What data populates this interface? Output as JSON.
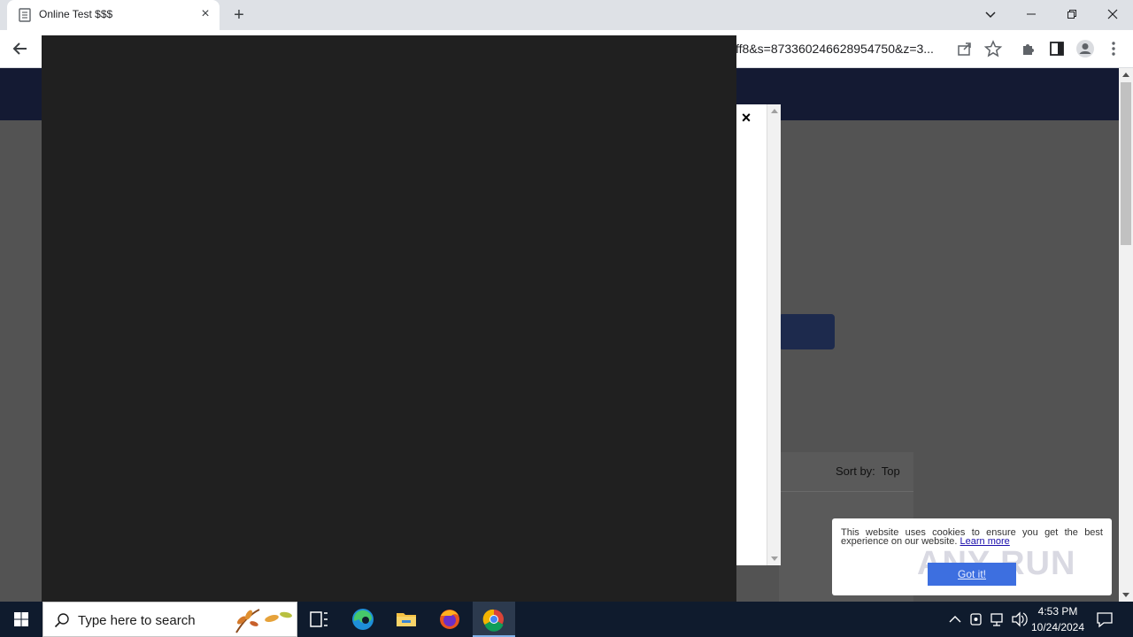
{
  "browser": {
    "tab_title": "Online Test $$$",
    "tab_close": "×",
    "new_tab": "+",
    "url_visible": "ff8&s=873360246628954750&z=3...",
    "window_controls": {
      "dropdown": "⌄",
      "minimize": "—",
      "restore": "❐",
      "close": "✕"
    }
  },
  "popup": {
    "close_label": "×"
  },
  "page": {
    "sort_label": "Sort by:",
    "sort_value": "Top"
  },
  "cookie": {
    "text": "This website uses cookies to ensure you get the best experience on our website.",
    "link": "Learn more",
    "button": "Got it!",
    "watermark": "ANY RUN"
  },
  "taskbar": {
    "search_placeholder": "Type here to search",
    "time": "4:53 PM",
    "date": "10/24/2024"
  },
  "colors": {
    "header": "#141a33",
    "overlay": "#202020",
    "page_bg": "#535353",
    "taskbar": "#0f1b2d",
    "cookie_button": "#3d6fe0"
  }
}
